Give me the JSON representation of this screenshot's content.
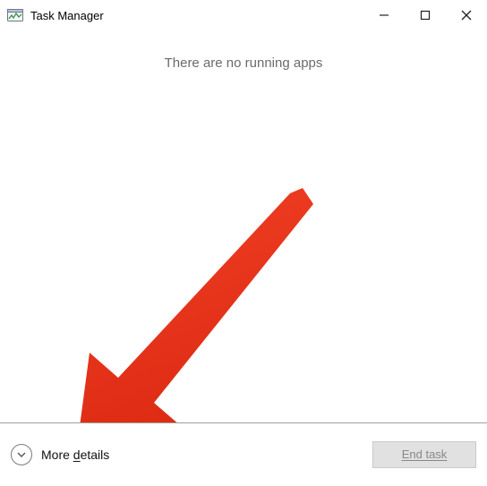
{
  "titlebar": {
    "title": "Task Manager"
  },
  "content": {
    "empty_message": "There are no running apps"
  },
  "footer": {
    "more_details_prefix": "More ",
    "more_details_ud": "d",
    "more_details_suffix": "etails",
    "end_task_prefix": "E",
    "end_task_ud": "n",
    "end_task_suffix": "d task"
  },
  "annotation": {
    "arrow_color": "#e8321c"
  }
}
